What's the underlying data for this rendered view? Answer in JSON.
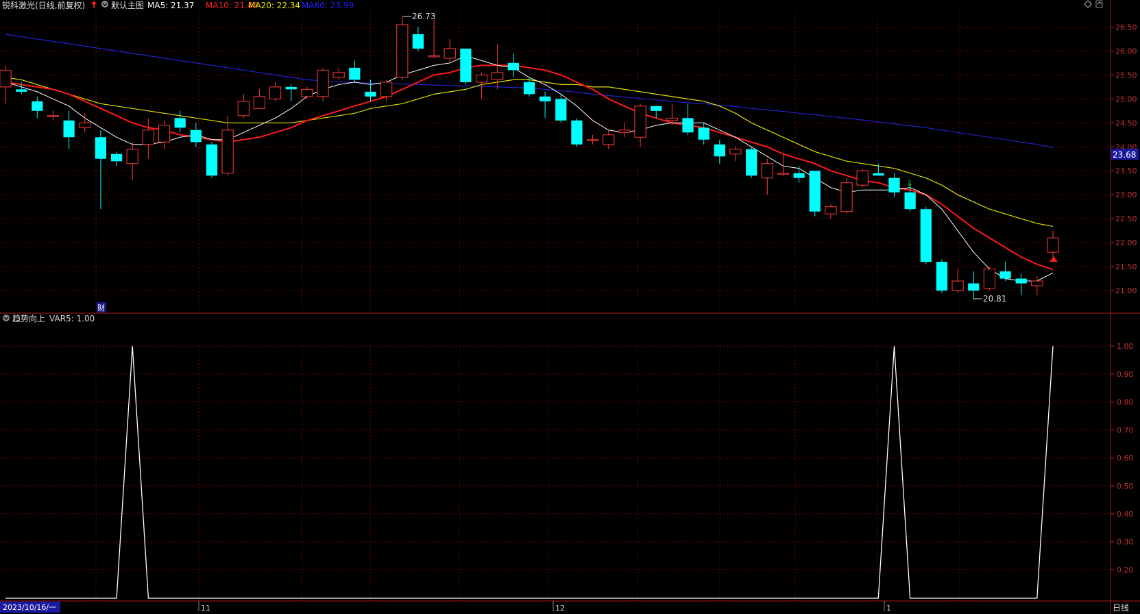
{
  "stock": {
    "name": "锐科激光",
    "period": "(日线,前复权)",
    "indicator_label": "默认主图"
  },
  "ma_values": [
    {
      "label": "MA5: 21.37",
      "color": "#ffffff"
    },
    {
      "label": "MA10: 21.44",
      "color": "#ff2020"
    },
    {
      "label": "MA20: 22.34",
      "color": "#e8e800"
    },
    {
      "label": "MA60: 23.99",
      "color": "#2020ff"
    }
  ],
  "colors": {
    "up": "#ff3b3b",
    "down": "#00ffff",
    "grid": "#7a0000",
    "axis_text": "#c83030",
    "ma5": "#ffffff",
    "ma10": "#ff1a1a",
    "ma20": "#e0e000",
    "ma60": "#2222cc",
    "sub_line": "#ffffff"
  },
  "price_axis": {
    "ticks": [
      "26.50",
      "26.00",
      "25.50",
      "25.00",
      "24.50",
      "24.00",
      "23.50",
      "23.00",
      "22.50",
      "22.00",
      "21.50",
      "21.00"
    ],
    "current": "23.68"
  },
  "annotations": {
    "high": "26.73",
    "low": "20.81",
    "fin_marker": "财"
  },
  "sub_panel": {
    "title": "趋势向上",
    "var_label": "VAR5: 1.00",
    "ticks": [
      "1.00",
      "0.90",
      "0.80",
      "0.70",
      "0.60",
      "0.50",
      "0.40",
      "0.30",
      "0.20"
    ]
  },
  "time_axis": {
    "start_date": "2023/10/16/一",
    "months": [
      "11",
      "12",
      "1"
    ],
    "period_button": "日线"
  },
  "icons": [
    "up-arrow-icon",
    "dropdown-icon",
    "diamond-icon",
    "scroll-icon"
  ],
  "chart_data": {
    "type": "candlestick",
    "ylim": [
      20.6,
      26.85
    ],
    "candles": [
      [
        25.25,
        25.6,
        25.7,
        24.9
      ],
      [
        25.2,
        25.15,
        25.35,
        25.1
      ],
      [
        24.95,
        24.75,
        25.05,
        24.6
      ],
      [
        24.65,
        24.65,
        24.75,
        24.55
      ],
      [
        24.55,
        24.2,
        24.75,
        23.95
      ],
      [
        24.4,
        24.5,
        24.7,
        24.3
      ],
      [
        24.2,
        23.75,
        24.35,
        22.7
      ],
      [
        23.85,
        23.7,
        23.9,
        23.6
      ],
      [
        23.65,
        23.95,
        24.1,
        23.3
      ],
      [
        24.05,
        24.35,
        24.6,
        23.75
      ],
      [
        24.1,
        24.45,
        24.55,
        23.95
      ],
      [
        24.6,
        24.4,
        24.75,
        24.3
      ],
      [
        24.35,
        24.1,
        24.5,
        24.0
      ],
      [
        24.05,
        23.4,
        24.1,
        23.35
      ],
      [
        23.45,
        24.35,
        24.65,
        23.4
      ],
      [
        24.65,
        24.95,
        25.1,
        24.6
      ],
      [
        24.8,
        25.05,
        25.2,
        24.8
      ],
      [
        25.0,
        25.25,
        25.35,
        24.95
      ],
      [
        25.25,
        25.2,
        25.3,
        24.95
      ],
      [
        25.05,
        25.2,
        25.25,
        25.0
      ],
      [
        25.05,
        25.6,
        25.65,
        24.95
      ],
      [
        25.45,
        25.55,
        25.65,
        25.4
      ],
      [
        25.65,
        25.4,
        25.8,
        25.35
      ],
      [
        25.15,
        25.05,
        25.4,
        24.95
      ],
      [
        25.05,
        25.35,
        25.4,
        24.95
      ],
      [
        25.45,
        26.55,
        26.73,
        25.4
      ],
      [
        26.35,
        26.05,
        26.5,
        26.0
      ],
      [
        25.9,
        25.9,
        26.65,
        25.85
      ],
      [
        25.85,
        26.05,
        26.25,
        25.75
      ],
      [
        26.05,
        25.35,
        26.05,
        25.3
      ],
      [
        25.35,
        25.5,
        25.55,
        25.0
      ],
      [
        25.4,
        25.55,
        26.15,
        25.2
      ],
      [
        25.75,
        25.6,
        25.95,
        25.45
      ],
      [
        25.35,
        25.1,
        25.45,
        25.05
      ],
      [
        25.05,
        24.95,
        25.15,
        24.6
      ],
      [
        25.0,
        24.55,
        25.1,
        24.5
      ],
      [
        24.55,
        24.05,
        24.6,
        24.0
      ],
      [
        24.15,
        24.15,
        24.25,
        24.05
      ],
      [
        24.05,
        24.25,
        24.35,
        23.95
      ],
      [
        24.3,
        24.35,
        24.5,
        24.2
      ],
      [
        24.2,
        24.85,
        24.9,
        24.0
      ],
      [
        24.85,
        24.75,
        24.85,
        24.6
      ],
      [
        24.55,
        24.6,
        24.9,
        24.45
      ],
      [
        24.6,
        24.3,
        24.9,
        24.25
      ],
      [
        24.4,
        24.15,
        24.5,
        24.05
      ],
      [
        24.05,
        23.8,
        24.15,
        23.65
      ],
      [
        23.85,
        23.95,
        24.0,
        23.7
      ],
      [
        23.95,
        23.4,
        24.0,
        23.35
      ],
      [
        23.35,
        23.65,
        23.75,
        23.0
      ],
      [
        23.45,
        23.45,
        23.85,
        23.4
      ],
      [
        23.45,
        23.35,
        23.6,
        23.25
      ],
      [
        23.5,
        22.65,
        23.5,
        22.55
      ],
      [
        22.6,
        22.75,
        22.8,
        22.5
      ],
      [
        22.65,
        23.25,
        23.35,
        22.6
      ],
      [
        23.2,
        23.5,
        23.55,
        23.15
      ],
      [
        23.45,
        23.4,
        23.65,
        23.4
      ],
      [
        23.35,
        23.05,
        23.45,
        22.95
      ],
      [
        23.05,
        22.7,
        23.25,
        22.65
      ],
      [
        22.7,
        21.6,
        22.75,
        21.55
      ],
      [
        21.6,
        21.0,
        21.65,
        20.95
      ],
      [
        21.0,
        21.2,
        21.45,
        20.95
      ],
      [
        21.15,
        21.0,
        21.4,
        20.81
      ],
      [
        21.05,
        21.45,
        21.5,
        21.0
      ],
      [
        21.4,
        21.25,
        21.6,
        21.2
      ],
      [
        21.25,
        21.15,
        21.35,
        20.9
      ],
      [
        21.1,
        21.2,
        21.3,
        20.9
      ],
      [
        21.8,
        22.1,
        22.25,
        21.7
      ]
    ],
    "ma5": [
      25.35,
      25.25,
      25.15,
      25.0,
      24.85,
      24.6,
      24.4,
      24.2,
      24.05,
      24.05,
      24.1,
      24.2,
      24.25,
      24.15,
      24.15,
      24.3,
      24.45,
      24.6,
      24.8,
      25.05,
      25.2,
      25.3,
      25.35,
      25.3,
      25.35,
      25.5,
      25.6,
      25.7,
      25.75,
      25.9,
      25.8,
      25.7,
      25.65,
      25.45,
      25.3,
      25.1,
      24.85,
      24.55,
      24.35,
      24.3,
      24.35,
      24.45,
      24.5,
      24.5,
      24.5,
      24.35,
      24.2,
      24.0,
      23.8,
      23.6,
      23.55,
      23.35,
      23.15,
      23.05,
      23.1,
      23.1,
      23.1,
      23.15,
      23.0,
      22.7,
      22.25,
      21.8,
      21.45,
      21.25,
      21.2,
      21.2,
      21.37
    ],
    "ma10": [
      25.35,
      25.3,
      25.25,
      25.2,
      25.1,
      24.95,
      24.8,
      24.65,
      24.5,
      24.4,
      24.35,
      24.25,
      24.2,
      24.15,
      24.1,
      24.15,
      24.2,
      24.3,
      24.4,
      24.55,
      24.65,
      24.75,
      24.85,
      24.95,
      25.05,
      25.2,
      25.35,
      25.5,
      25.55,
      25.65,
      25.7,
      25.7,
      25.7,
      25.65,
      25.6,
      25.5,
      25.35,
      25.2,
      25.0,
      24.85,
      24.7,
      24.6,
      24.5,
      24.45,
      24.4,
      24.3,
      24.2,
      24.1,
      24.0,
      23.85,
      23.75,
      23.65,
      23.5,
      23.4,
      23.3,
      23.25,
      23.15,
      23.1,
      23.0,
      22.8,
      22.55,
      22.3,
      22.1,
      21.9,
      21.7,
      21.55,
      21.44
    ],
    "ma20": [
      25.45,
      25.4,
      25.3,
      25.2,
      25.1,
      25.0,
      24.9,
      24.85,
      24.8,
      24.75,
      24.7,
      24.65,
      24.6,
      24.55,
      24.5,
      24.5,
      24.5,
      24.5,
      24.5,
      24.55,
      24.6,
      24.65,
      24.7,
      24.8,
      24.85,
      24.9,
      25.0,
      25.1,
      25.15,
      25.2,
      25.3,
      25.35,
      25.4,
      25.4,
      25.35,
      25.3,
      25.3,
      25.25,
      25.25,
      25.2,
      25.15,
      25.1,
      25.05,
      25.0,
      24.95,
      24.85,
      24.7,
      24.5,
      24.35,
      24.2,
      24.05,
      23.9,
      23.8,
      23.7,
      23.65,
      23.6,
      23.55,
      23.45,
      23.35,
      23.2,
      23.0,
      22.85,
      22.7,
      22.6,
      22.5,
      22.4,
      22.34
    ],
    "ma60": [
      26.35,
      26.3,
      26.25,
      26.2,
      26.15,
      26.1,
      26.05,
      26.0,
      25.95,
      25.9,
      25.85,
      25.8,
      25.75,
      25.7,
      25.65,
      25.6,
      25.55,
      25.5,
      25.45,
      25.4,
      25.38,
      25.36,
      25.34,
      25.33,
      25.32,
      25.31,
      25.3,
      25.29,
      25.28,
      25.27,
      25.26,
      25.25,
      25.24,
      25.23,
      25.2,
      25.17,
      25.14,
      25.1,
      25.07,
      25.04,
      25.01,
      24.98,
      24.95,
      24.92,
      24.9,
      24.87,
      24.84,
      24.8,
      24.77,
      24.74,
      24.7,
      24.67,
      24.63,
      24.6,
      24.56,
      24.52,
      24.48,
      24.44,
      24.4,
      24.35,
      24.3,
      24.25,
      24.2,
      24.15,
      24.1,
      24.05,
      23.99
    ],
    "var5": [
      0,
      0,
      0,
      0,
      0,
      0,
      0,
      0,
      1,
      0,
      0,
      0,
      0,
      0,
      0,
      0,
      0,
      0,
      0,
      0,
      0,
      0,
      0,
      0,
      0,
      0,
      0,
      0,
      0,
      0,
      0,
      0,
      0,
      0,
      0,
      0,
      0,
      0,
      0,
      0,
      0,
      0,
      0,
      0,
      0,
      0,
      0,
      0,
      0,
      0,
      0,
      0,
      0,
      0,
      0,
      0,
      1,
      0,
      0,
      0,
      0,
      0,
      0,
      0,
      0,
      0,
      1
    ]
  }
}
